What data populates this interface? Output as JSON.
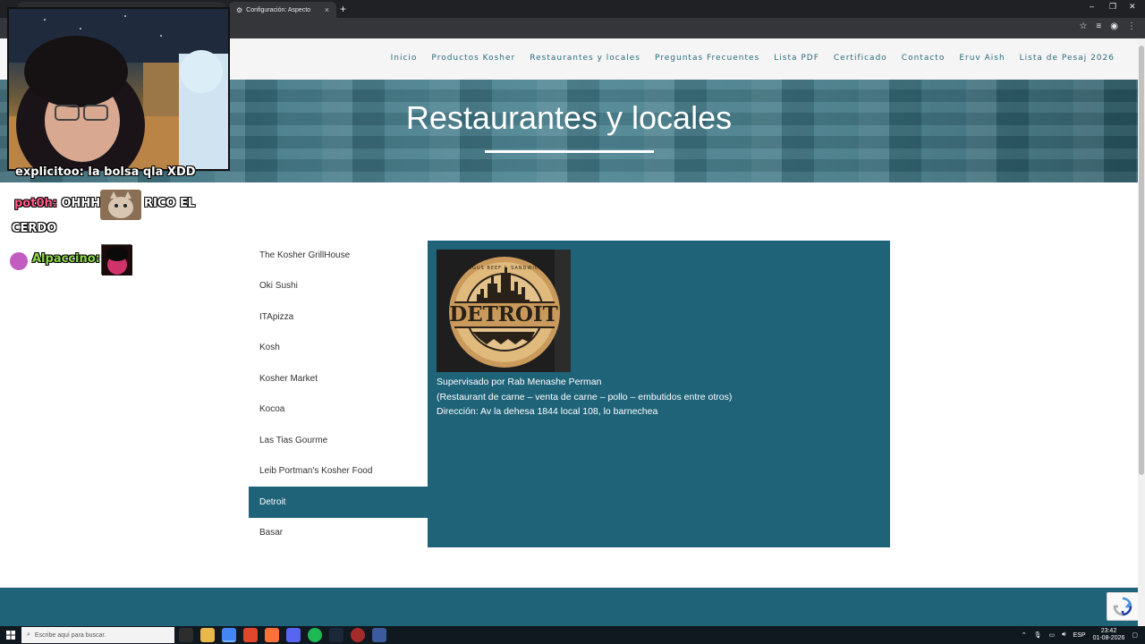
{
  "browser": {
    "tabs": [
      {
        "label": "",
        "active": false
      },
      {
        "label": "Configuración: Aspecto",
        "active": true
      }
    ],
    "new_tab": "+",
    "close_glyph": "×",
    "window_controls": {
      "minimize": "–",
      "restore": "❐",
      "close": "✕"
    }
  },
  "header": {
    "nav": [
      "Inicio",
      "Productos Kosher",
      "Restaurantes y locales",
      "Preguntas Frecuentes",
      "Lista PDF",
      "Certificado",
      "Contacto",
      "Eruv Aish",
      "Lista de Pesaj 2026"
    ]
  },
  "hero": {
    "title": "Restaurantes y locales"
  },
  "restaurants": {
    "items": [
      {
        "label": "The Kosher GrillHouse",
        "active": false
      },
      {
        "label": "Oki Sushi",
        "active": false
      },
      {
        "label": "ITApizza",
        "active": false
      },
      {
        "label": "Kosh",
        "active": false
      },
      {
        "label": "Kosher Market",
        "active": false
      },
      {
        "label": "Kocoa",
        "active": false
      },
      {
        "label": "Las Tias Gourme",
        "active": false
      },
      {
        "label": "Leib Portman's Kosher Food",
        "active": false
      },
      {
        "label": "Detroit",
        "active": true
      },
      {
        "label": "Basar",
        "active": false
      }
    ]
  },
  "detail": {
    "logo_text": "DETROIT",
    "logo_arc_text": "ANGUS BEEF & SANDWICH",
    "supervision": "Supervisado por Rab Menashe Perman",
    "description": "(Restaurant de carne – venta de carne – pollo – embutidos entre otros)",
    "address": "Dirección: Av la dehesa 1844 local 108, lo barnechea"
  },
  "overlay": {
    "chat": [
      {
        "user": "",
        "message": "explicitoo: la bolsa qla XDD"
      },
      {
        "user": "pot0h:",
        "message": "OHHH",
        "message2": "RICO EL",
        "message3": "CERDO"
      },
      {
        "user": "Alpaccino:",
        "message": ""
      }
    ]
  },
  "taskbar": {
    "search_placeholder": "Escribe aquí para buscar.",
    "language": "ESP",
    "time": "23:42",
    "date": "01-08-2026"
  },
  "colors": {
    "brand_teal": "#1f6379",
    "nav_text": "#2a6b7f",
    "header_bg": "#f5f5f5"
  }
}
